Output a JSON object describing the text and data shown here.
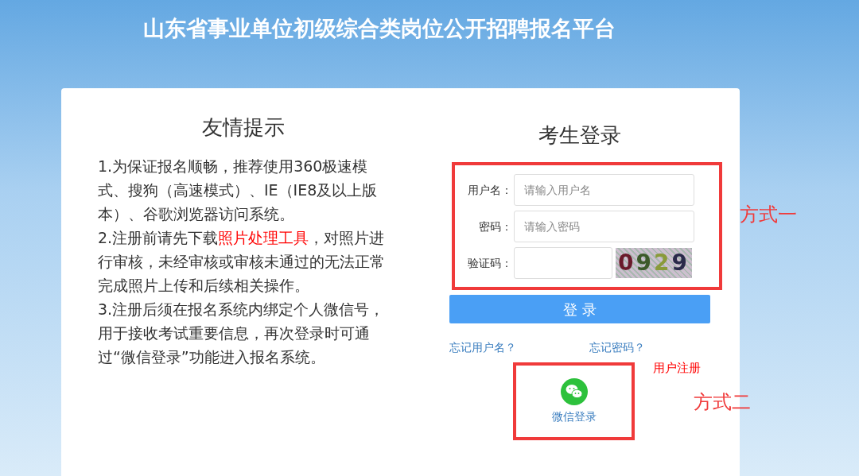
{
  "title": "山东省事业单位初级综合类岗位公开招聘报名平台",
  "tips": {
    "heading": "友情提示",
    "items": [
      {
        "segments": [
          {
            "kind": "text",
            "text": "1.为保证报名顺畅，推荐使用360极速模式、搜狗（高速模式）、IE（IE8及以上版本）、谷歌浏览器访问系统。"
          }
        ]
      },
      {
        "segments": [
          {
            "kind": "text",
            "text": "2.注册前请先下载"
          },
          {
            "kind": "link",
            "text": "照片处理工具"
          },
          {
            "kind": "text",
            "text": "，对照片进行审核，未经审核或审核未通过的无法正常完成照片上传和后续相关操作。"
          }
        ]
      },
      {
        "segments": [
          {
            "kind": "text",
            "text": "3.注册后须在报名系统内绑定个人微信号，用于接收考试重要信息，再次登录时可通过“微信登录”功能进入报名系统。"
          }
        ]
      }
    ]
  },
  "login": {
    "heading": "考生登录",
    "fields": [
      {
        "kind": "text",
        "label": "用户名：",
        "placeholder": "请输入用户名"
      },
      {
        "kind": "password",
        "label": "密码：",
        "placeholder": "请输入密码"
      },
      {
        "kind": "captcha",
        "label": "验证码：",
        "captcha": "0929"
      }
    ],
    "submit": "登 录",
    "links": [
      "忘记用户名？",
      "忘记密码？"
    ],
    "register": "用户注册",
    "wechat_login": "微信登录"
  },
  "annotations": [
    {
      "text": "方式一"
    },
    {
      "text": "方式二"
    }
  ]
}
